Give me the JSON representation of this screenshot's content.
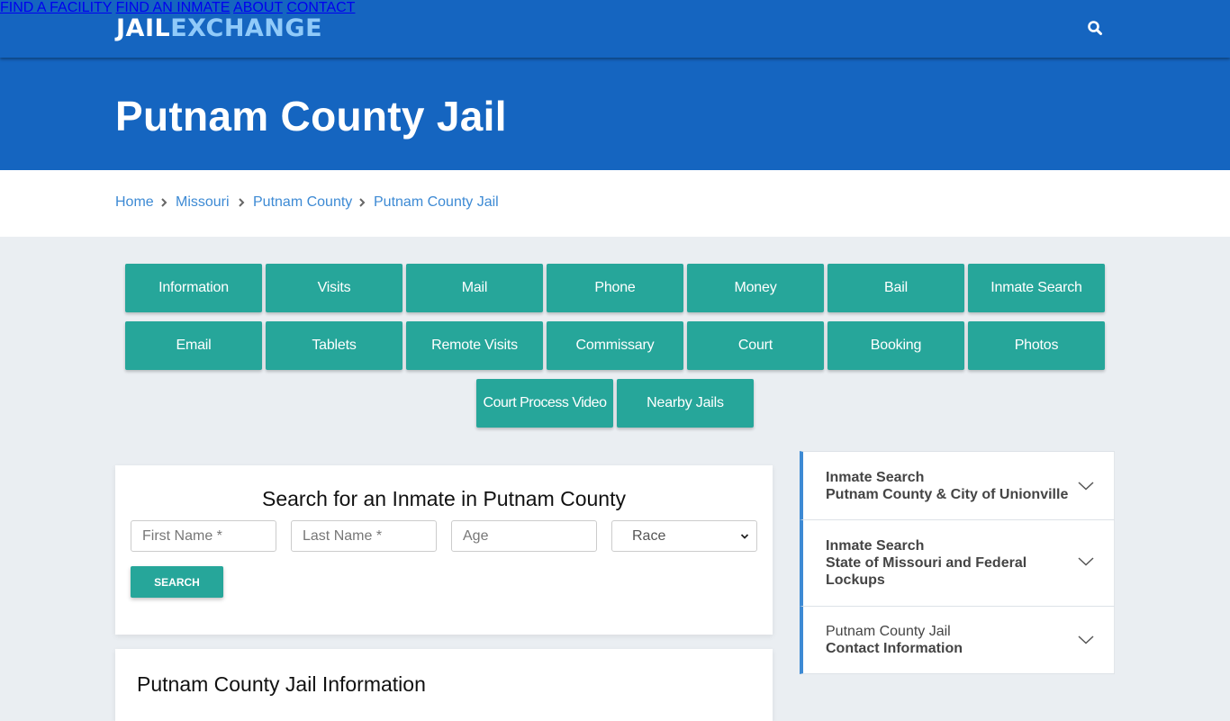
{
  "brand": {
    "logo_part1": "JAIL",
    "logo_part2": "EXCHANGE"
  },
  "nav": {
    "items": [
      "FIND A FACILITY",
      "FIND AN INMATE",
      "ABOUT",
      "CONTACT"
    ],
    "search_icon": "search-icon"
  },
  "hero": {
    "title": "Putnam County Jail"
  },
  "breadcrumb": [
    "Home",
    "Missouri",
    "Putnam County",
    "Putnam County Jail"
  ],
  "topic_buttons": {
    "row1": [
      "Information",
      "Visits",
      "Mail",
      "Phone",
      "Money",
      "Bail",
      "Inmate Search"
    ],
    "row2": [
      "Email",
      "Tablets",
      "Remote Visits",
      "Commissary",
      "Court",
      "Booking",
      "Photos"
    ],
    "row3": [
      "Court Process Video",
      "Nearby Jails"
    ]
  },
  "search_form": {
    "title": "Search for an Inmate in Putnam County",
    "first_name_placeholder": "First Name *",
    "last_name_placeholder": "Last Name *",
    "age_placeholder": "Age",
    "race_selected": "Race",
    "submit_label": "SEARCH"
  },
  "info_section": {
    "title": "Putnam County Jail Information"
  },
  "sidebar": {
    "accordion": [
      {
        "line1": "Inmate Search",
        "line2": "Putnam County & City of Unionville",
        "line3": ""
      },
      {
        "line1": "Inmate Search",
        "line2": "State of Missouri and Federal",
        "line3": "Lockups"
      },
      {
        "line1": "Putnam County Jail",
        "line2": "Contact Information",
        "line3": ""
      }
    ]
  },
  "colors": {
    "primary_blue": "#1565c0",
    "accent_teal": "#26a69a",
    "link_blue": "#3d8ad4",
    "logo_light": "#90caf9"
  }
}
